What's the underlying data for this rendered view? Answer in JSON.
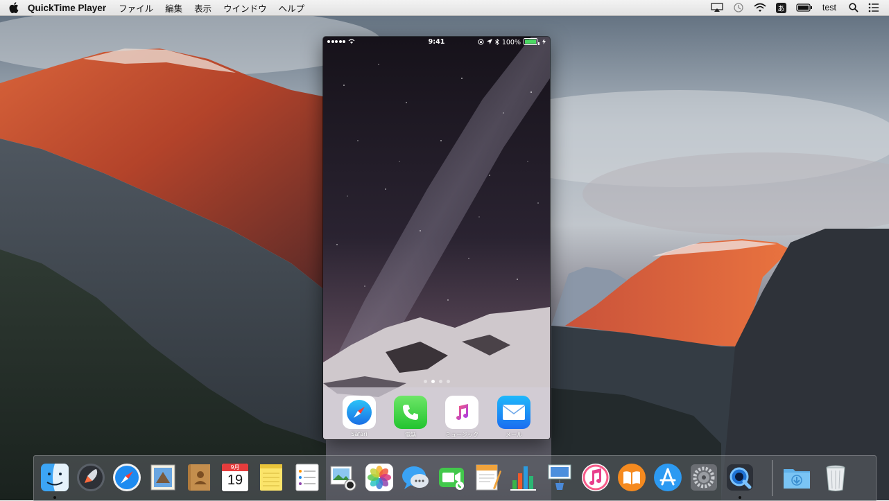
{
  "menubar": {
    "app_name": "QuickTime Player",
    "menus": [
      "ファイル",
      "編集",
      "表示",
      "ウインドウ",
      "ヘルプ"
    ],
    "ime_label": "あ",
    "user": "test"
  },
  "phone": {
    "status": {
      "time": "9:41",
      "battery": "100%"
    },
    "page_count": 4,
    "current_page": 2,
    "dock_apps": [
      {
        "name": "safari",
        "label": "Safari"
      },
      {
        "name": "phone",
        "label": "電話"
      },
      {
        "name": "music",
        "label": "ミュージック"
      },
      {
        "name": "mail",
        "label": "メール"
      }
    ]
  },
  "dock": {
    "apps": [
      {
        "name": "finder",
        "running": true
      },
      {
        "name": "launchpad"
      },
      {
        "name": "safari"
      },
      {
        "name": "mail"
      },
      {
        "name": "contacts"
      },
      {
        "name": "calendar",
        "month": "9月",
        "day": "19"
      },
      {
        "name": "notes"
      },
      {
        "name": "reminders"
      },
      {
        "name": "photo-booth"
      },
      {
        "name": "photos"
      },
      {
        "name": "messages"
      },
      {
        "name": "facetime"
      },
      {
        "name": "pages"
      },
      {
        "name": "numbers"
      },
      {
        "name": "keynote"
      },
      {
        "name": "itunes"
      },
      {
        "name": "ibooks"
      },
      {
        "name": "app-store"
      },
      {
        "name": "system-preferences"
      },
      {
        "name": "quicktime-player",
        "running": true
      }
    ],
    "extras": [
      {
        "name": "downloads-folder"
      },
      {
        "name": "trash"
      }
    ]
  }
}
